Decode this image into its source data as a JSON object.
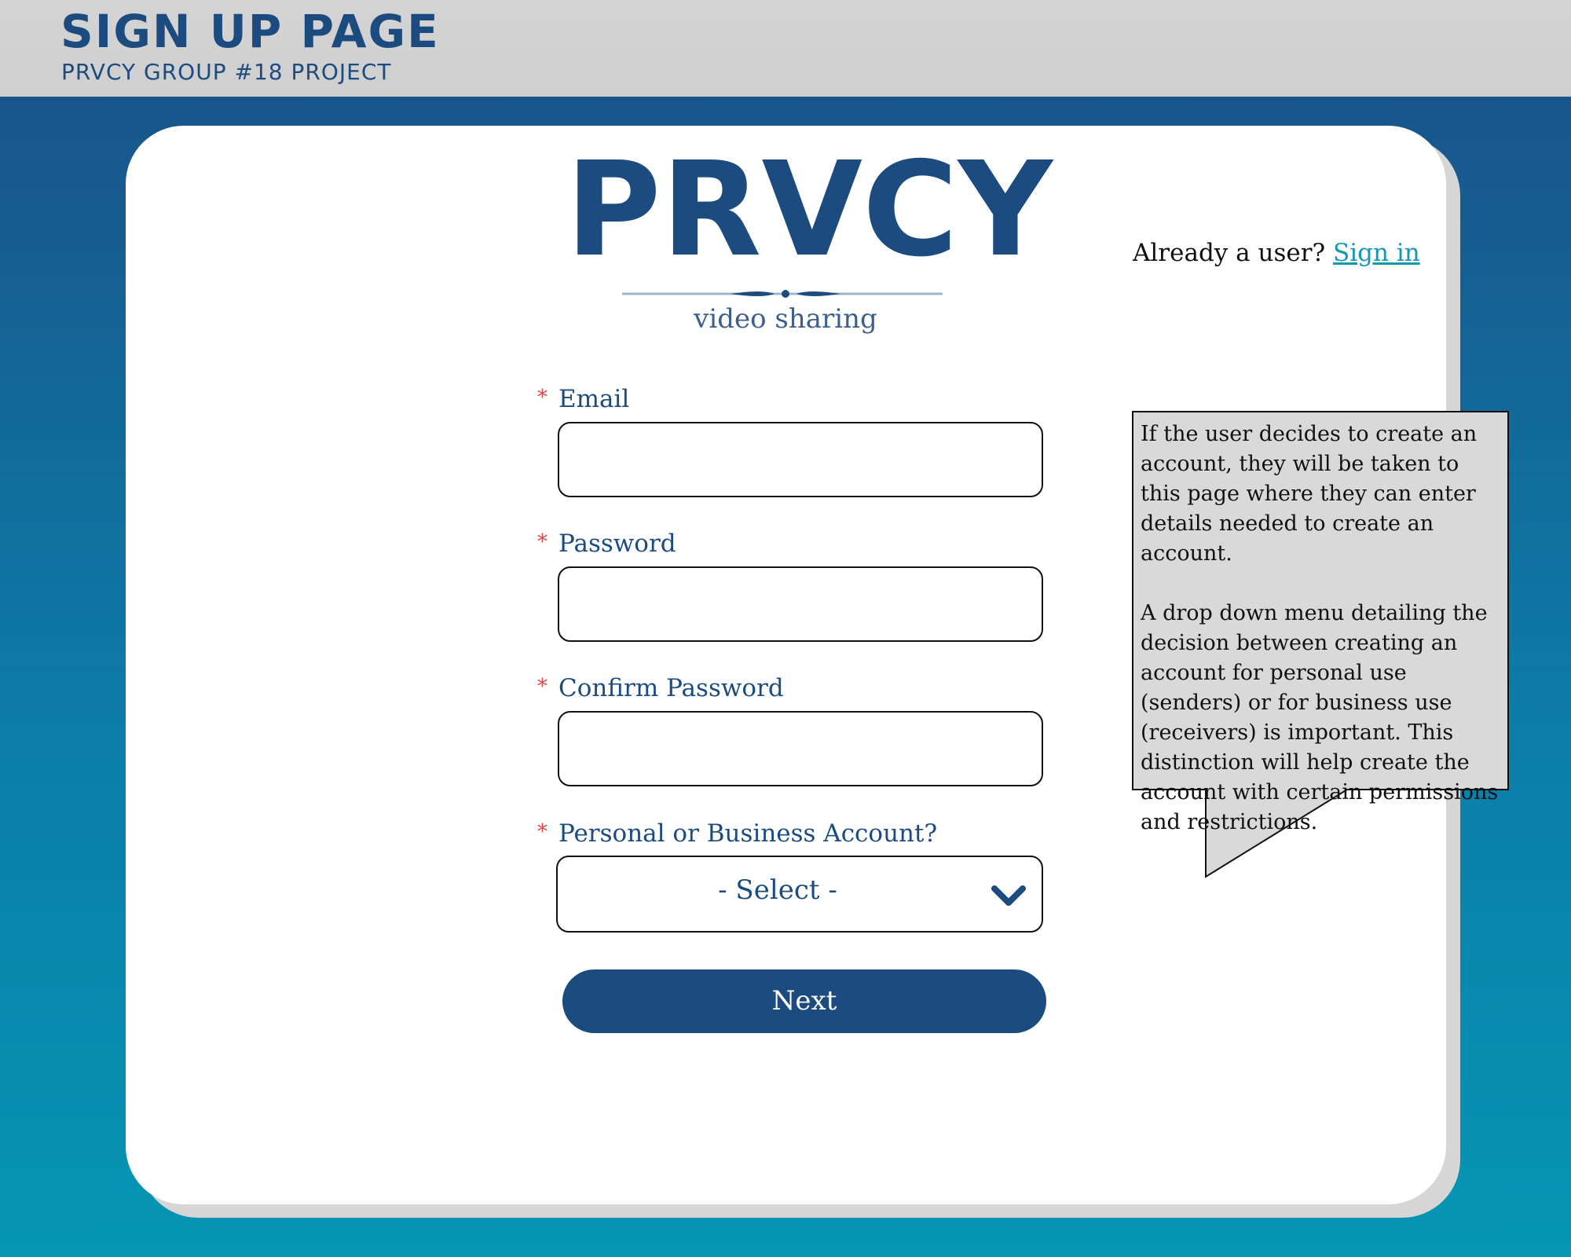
{
  "header": {
    "title": "SIGN UP PAGE",
    "subtitle": "PRVCY GROUP #18 PROJECT"
  },
  "logo": {
    "wordmark": "PRVCY",
    "tagline": "video sharing"
  },
  "signin": {
    "prompt": "Already a user?",
    "link_label": "Sign in"
  },
  "form": {
    "required_marker": "*",
    "email_label": "Email",
    "password_label": "Password",
    "confirm_password_label": "Confirm Password",
    "account_type_label": "Personal or Business Account?",
    "account_type_selected": "- Select -",
    "next_label": "Next"
  },
  "annotation": {
    "paragraph_1": "If the user decides to create an account, they will be taken to this page where they can enter details needed to create an account.",
    "paragraph_2": "A drop down menu detailing the decision between creating an account for personal use (senders) or for business use (receivers) is important. This distinction will help create the account with certain permissions and restrictions."
  },
  "colors": {
    "brand_navy": "#1c4b80",
    "link_teal": "#1598b0",
    "required_red": "#e04848",
    "header_gray": "#d0d0d0"
  }
}
